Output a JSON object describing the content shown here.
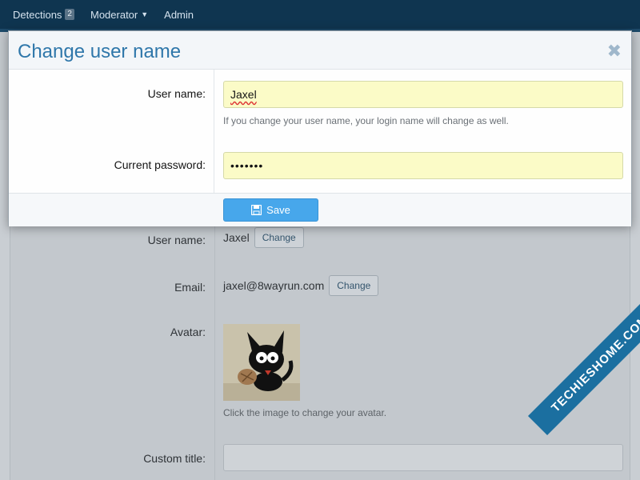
{
  "nav": {
    "items": [
      {
        "label": "Detections",
        "badge": "2"
      },
      {
        "label": "Moderator"
      },
      {
        "label": "Admin"
      }
    ]
  },
  "modal": {
    "title": "Change user name",
    "close_icon": "close-icon",
    "username_label": "User name:",
    "username_value": "Jaxel",
    "username_hint": "If you change your user name, your login name will change as well.",
    "password_label": "Current password:",
    "password_value": "•••••••",
    "save_label": "Save",
    "save_icon": "save-icon"
  },
  "background": {
    "username_label": "User name:",
    "username_value": "Jaxel",
    "username_change": "Change",
    "email_label": "Email:",
    "email_value": "jaxel@8wayrun.com",
    "email_change": "Change",
    "avatar_label": "Avatar:",
    "avatar_hint": "Click the image to change your avatar.",
    "custom_title_label": "Custom title:"
  },
  "watermark": "TECHIESHOME.COM",
  "colors": {
    "nav_bg": "#0f3550",
    "title": "#2f77aa",
    "save_bg": "#47a7eb",
    "input_autofill": "#fbfbc7"
  }
}
